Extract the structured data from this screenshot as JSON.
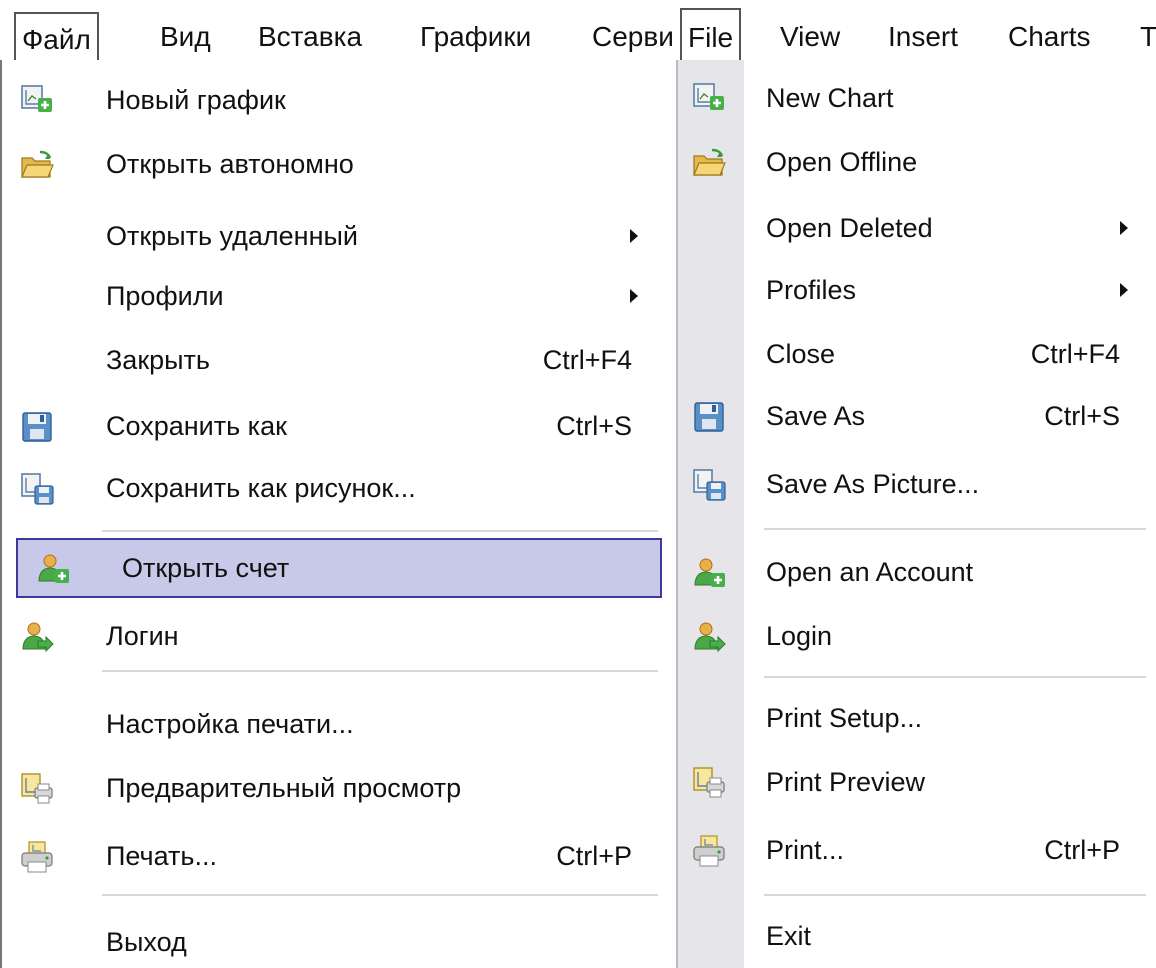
{
  "ru": {
    "menubar": [
      "Файл",
      "Вид",
      "Вставка",
      "Графики",
      "Серви"
    ],
    "items": [
      {
        "label": "Новый график",
        "shortcut": "",
        "submenu": false,
        "icon": "new-chart-icon"
      },
      {
        "label": "Открыть автономно",
        "shortcut": "",
        "submenu": false,
        "icon": "open-folder-icon"
      },
      {
        "label": "Открыть удаленный",
        "shortcut": "",
        "submenu": true,
        "icon": ""
      },
      {
        "label": "Профили",
        "shortcut": "",
        "submenu": true,
        "icon": ""
      },
      {
        "label": "Закрыть",
        "shortcut": "Ctrl+F4",
        "submenu": false,
        "icon": ""
      },
      {
        "label": "Сохранить как",
        "shortcut": "Ctrl+S",
        "submenu": false,
        "icon": "floppy-disk-icon"
      },
      {
        "label": "Сохранить как рисунок...",
        "shortcut": "",
        "submenu": false,
        "icon": "save-picture-icon"
      },
      {
        "label": "Открыть счет",
        "shortcut": "",
        "submenu": false,
        "icon": "user-add-icon",
        "highlighted": true
      },
      {
        "label": "Логин",
        "shortcut": "",
        "submenu": false,
        "icon": "user-login-icon"
      },
      {
        "label": "Настройка печати...",
        "shortcut": "",
        "submenu": false,
        "icon": ""
      },
      {
        "label": "Предварительный просмотр",
        "shortcut": "",
        "submenu": false,
        "icon": "print-preview-icon"
      },
      {
        "label": "Печать...",
        "shortcut": "Ctrl+P",
        "submenu": false,
        "icon": "printer-icon"
      },
      {
        "label": "Выход",
        "shortcut": "",
        "submenu": false,
        "icon": ""
      }
    ]
  },
  "en": {
    "menubar": [
      "File",
      "View",
      "Insert",
      "Charts",
      "T"
    ],
    "items": [
      {
        "label": "New Chart",
        "shortcut": "",
        "submenu": false,
        "icon": "new-chart-icon"
      },
      {
        "label": "Open Offline",
        "shortcut": "",
        "submenu": false,
        "icon": "open-folder-icon"
      },
      {
        "label": "Open Deleted",
        "shortcut": "",
        "submenu": true,
        "icon": ""
      },
      {
        "label": "Profiles",
        "shortcut": "",
        "submenu": true,
        "icon": ""
      },
      {
        "label": "Close",
        "shortcut": "Ctrl+F4",
        "submenu": false,
        "icon": ""
      },
      {
        "label": "Save As",
        "shortcut": "Ctrl+S",
        "submenu": false,
        "icon": "floppy-disk-icon"
      },
      {
        "label": "Save As Picture...",
        "shortcut": "",
        "submenu": false,
        "icon": "save-picture-icon"
      },
      {
        "label": "Open an Account",
        "shortcut": "",
        "submenu": false,
        "icon": "user-add-icon"
      },
      {
        "label": "Login",
        "shortcut": "",
        "submenu": false,
        "icon": "user-login-icon"
      },
      {
        "label": "Print Setup...",
        "shortcut": "",
        "submenu": false,
        "icon": ""
      },
      {
        "label": "Print Preview",
        "shortcut": "",
        "submenu": false,
        "icon": "print-preview-icon"
      },
      {
        "label": "Print...",
        "shortcut": "Ctrl+P",
        "submenu": false,
        "icon": "printer-icon"
      },
      {
        "label": "Exit",
        "shortcut": "",
        "submenu": false,
        "icon": ""
      }
    ]
  },
  "colors": {
    "highlight_bg": "#c8c8e8",
    "highlight_border": "#3a3a9a",
    "icon_strip": "#e6e6ea"
  }
}
